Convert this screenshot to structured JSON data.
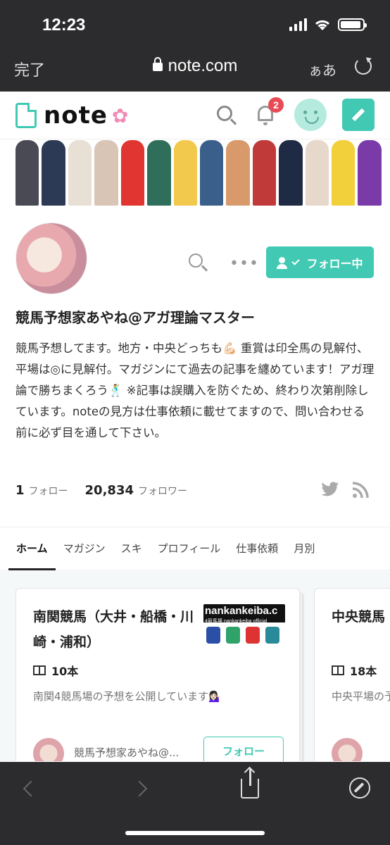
{
  "status": {
    "time": "12:23"
  },
  "browser": {
    "done_label": "完了",
    "url": "note.com",
    "text_size_label": "ぁあ"
  },
  "header": {
    "logo_text": "note",
    "notification_count": "2"
  },
  "banner": {
    "figure_colors": [
      "#4a4a55",
      "#2d3a55",
      "#e8e0d5",
      "#d9c5b5",
      "#e03530",
      "#2e6e5a",
      "#f2c94c",
      "#3a5f8a",
      "#d89a6a",
      "#c03a3a",
      "#1f2a44",
      "#e7d8cc",
      "#f2d03b",
      "#7a3aa8"
    ]
  },
  "profile": {
    "name": "競馬予想家あやね@アガ理論マスター",
    "follow_label": "フォロー中",
    "bio": "競馬予想してます。地方・中央どっちも💪🏻 重賞は印全馬の見解付、平場は◎に見解付。マガジンにて過去の記事を纏めています！アガ理論で勝ちまくろう🕺 ※記事は誤購入を防ぐため、終わり次第削除しています。noteの見方は仕事依頼に載せてますので、問い合わせる前に必ず目を通して下さい。",
    "following_count": "1",
    "following_label": "フォロー",
    "followers_count": "20,834",
    "followers_label": "フォロワー"
  },
  "tabs": [
    {
      "label": "ホーム",
      "active": true
    },
    {
      "label": "マガジン"
    },
    {
      "label": "スキ"
    },
    {
      "label": "プロフィール"
    },
    {
      "label": "仕事依頼"
    },
    {
      "label": "月別"
    }
  ],
  "magazines": [
    {
      "title": "南関競馬（大井・船橋・川崎・浦和）",
      "thumb_text": "nankankeiba.c",
      "thumb_sub": "4競馬場   nankankeiba official",
      "count": "10本",
      "description": "南関4競馬場の予想を公開しています💁🏻‍♀️",
      "author": "競馬予想家あやね@...",
      "follow_label": "フォロー"
    },
    {
      "title": "中央競馬",
      "count": "18本",
      "description": "中央平場の予"
    }
  ],
  "colors": {
    "accent": "#41c9b4",
    "badge": "#e84b55"
  }
}
